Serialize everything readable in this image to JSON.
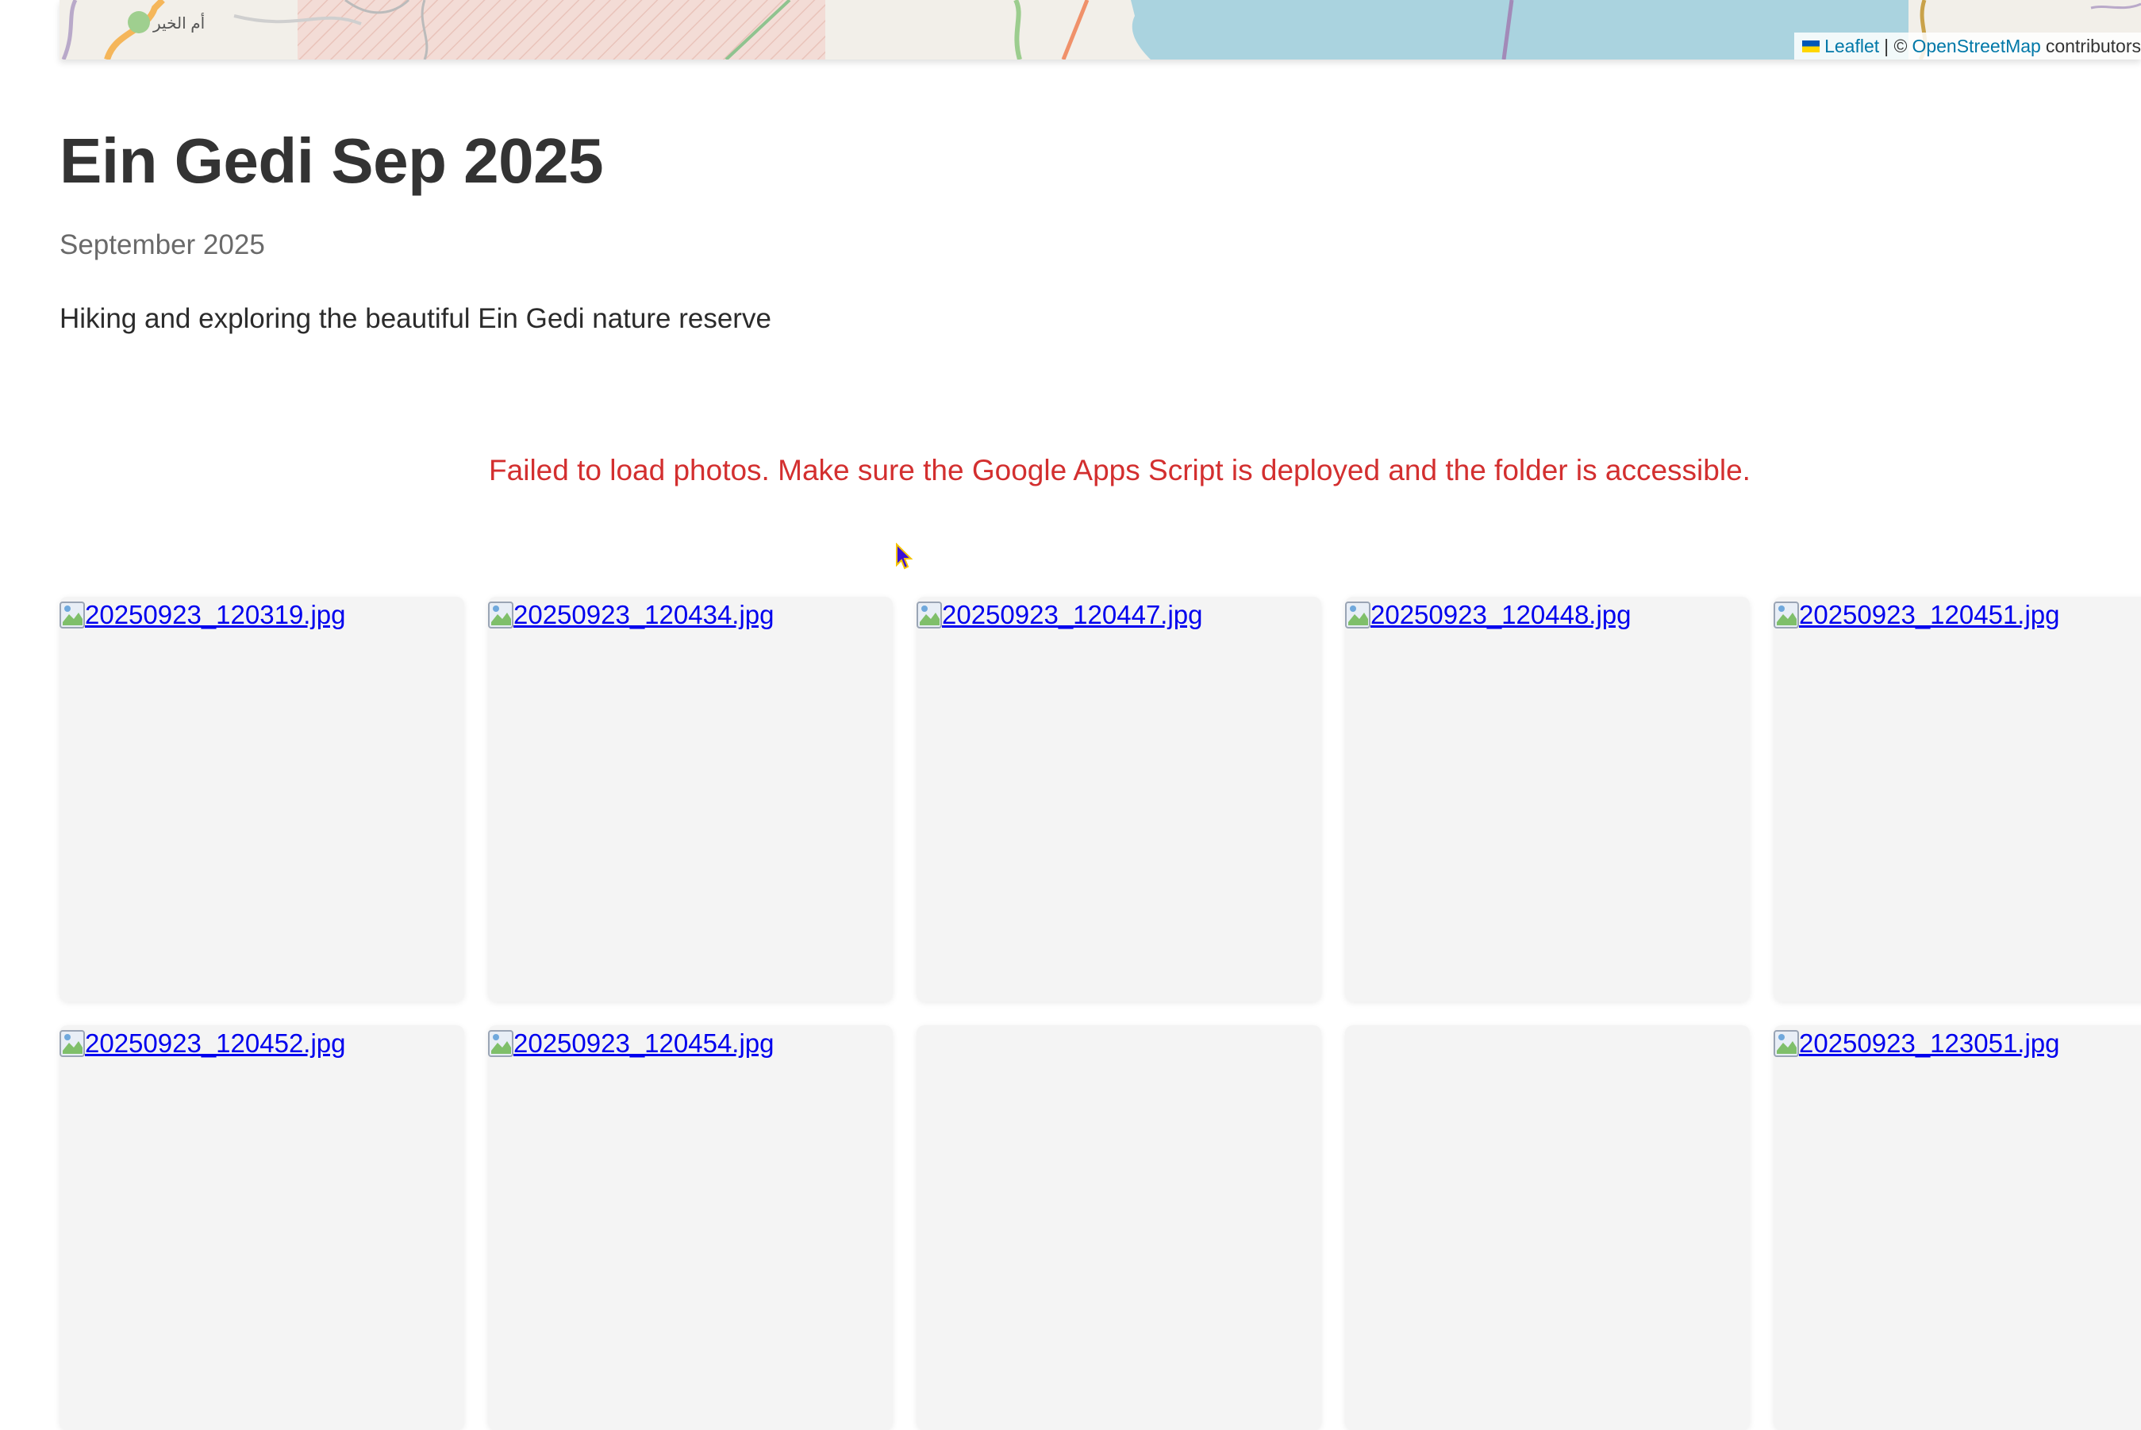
{
  "map": {
    "place_label": "أم الخير",
    "attribution": {
      "leaflet": "Leaflet",
      "separator": "| ©",
      "osm": "OpenStreetMap",
      "trailing": "contributors"
    }
  },
  "album": {
    "title": "Ein Gedi Sep 2025",
    "date": "September 2025",
    "description": "Hiking and exploring the beautiful Ein Gedi nature reserve"
  },
  "error": {
    "message": "Failed to load photos. Make sure the Google Apps Script is deployed and the folder is accessible."
  },
  "photos": [
    {
      "name": "20250923_120319.jpg"
    },
    {
      "name": "20250923_120434.jpg"
    },
    {
      "name": "20250923_120447.jpg"
    },
    {
      "name": "20250923_120448.jpg"
    },
    {
      "name": "20250923_120451.jpg"
    },
    {
      "name": "20250923_120452.jpg"
    },
    {
      "name": "20250923_120454.jpg"
    },
    {
      "name": ""
    },
    {
      "name": ""
    },
    {
      "name": "20250923_123051.jpg"
    }
  ],
  "colors": {
    "error": "#d32f2f",
    "link": "#0000ee",
    "map_water": "#aad3df",
    "tile_bg": "#f4f4f4"
  }
}
